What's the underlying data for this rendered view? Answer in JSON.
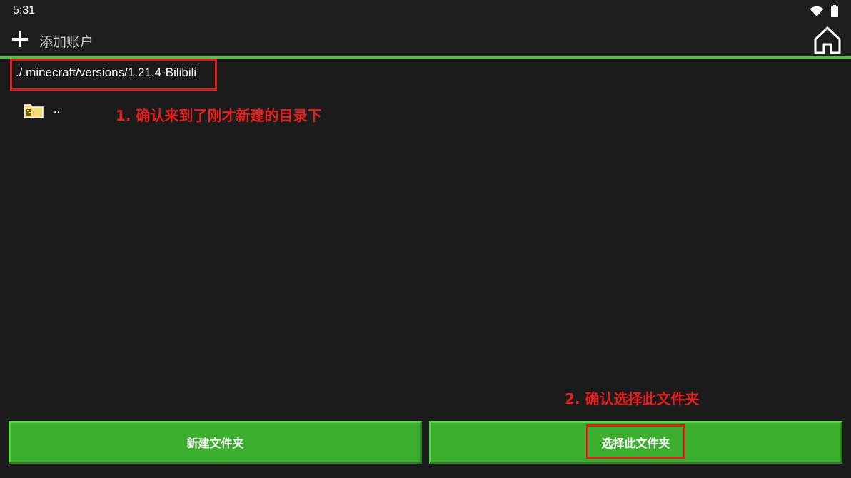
{
  "status_bar": {
    "time": "5:31",
    "wifi_icon": "wifi-icon",
    "battery_icon": "battery-icon"
  },
  "toolbar": {
    "add_icon": "plus-icon",
    "add_account_label": "添加账户",
    "home_icon": "home-icon",
    "accent_color": "#4fc33a"
  },
  "file_browser": {
    "current_path": "./.minecraft/versions/1.21.4-Bilibili",
    "entries": [
      {
        "name": "..",
        "icon": "folder-icon"
      }
    ]
  },
  "annotations": {
    "step1": "1. 确认来到了刚才新建的目录下",
    "step2": "2. 确认选择此文件夹",
    "highlight_color": "#e01b1b"
  },
  "actions": {
    "new_folder_label": "新建文件夹",
    "select_folder_label": "选择此文件夹",
    "button_color": "#3cae2e"
  }
}
